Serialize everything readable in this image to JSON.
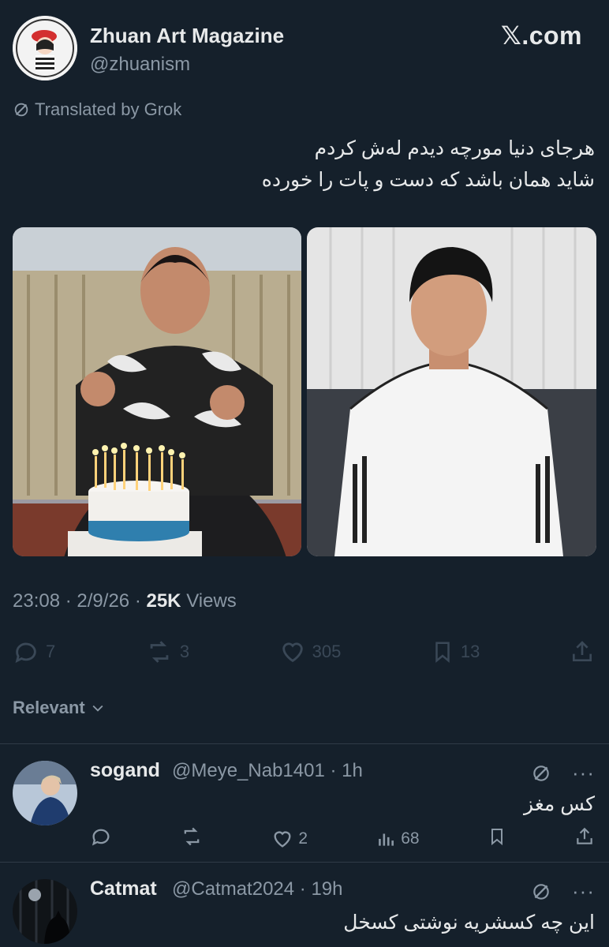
{
  "author": {
    "name": "Zhuan Art Magazine",
    "handle": "@zhuanism"
  },
  "brand": "𝕏.com",
  "translation": {
    "label": "Translated by Grok"
  },
  "post": {
    "line1": "هرجای دنیا مورچه دیدم له‌ش کردم",
    "line2": "شاید همان باشد که دست و پات را خورده"
  },
  "meta": {
    "time": "23:08",
    "date": "2/9/26",
    "views_count": "25K",
    "views_label": "Views"
  },
  "stats": {
    "replies": "7",
    "reposts": "3",
    "likes": "305",
    "bookmarks": "13"
  },
  "sort": {
    "label": "Relevant"
  },
  "replies": [
    {
      "name": "sogand",
      "handle": "@Meye_Nab1401",
      "time": "1h",
      "text": "کس مغز",
      "likes": "2",
      "views": "68"
    },
    {
      "name": "Catmat",
      "handle": "@Catmat2024",
      "time": "19h",
      "text": "این چه کسشریه نوشتی کسخل"
    }
  ],
  "colors": {
    "background": "#15202b",
    "text": "#e7e9ea",
    "muted": "#8b98a5",
    "divider": "#2f3b47"
  }
}
